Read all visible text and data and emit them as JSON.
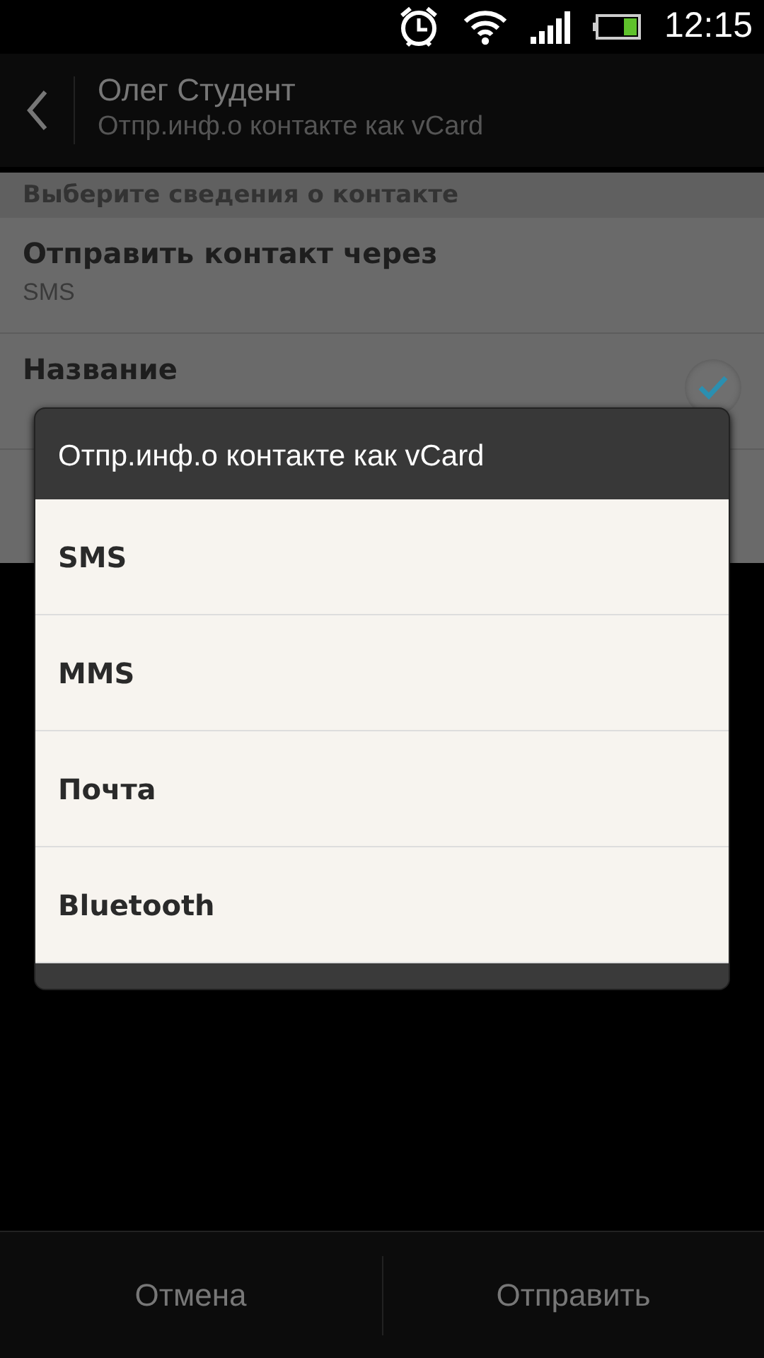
{
  "status_bar": {
    "time": "12:15"
  },
  "header": {
    "title": "Олег Студент",
    "subtitle": "Отпр.инф.о контакте как vCard"
  },
  "section_header": "Выберите сведения о контакте",
  "settings": [
    {
      "kind": "value",
      "title": "Отправить контакт через",
      "value": "SMS"
    },
    {
      "kind": "checkbox",
      "title": "Название",
      "checked": true
    }
  ],
  "dialog": {
    "title": "Отпр.инф.о контакте как vCard",
    "options": [
      "SMS",
      "MMS",
      "Почта",
      "Bluetooth"
    ]
  },
  "buttons": [
    "Отмена",
    "Отправить"
  ]
}
